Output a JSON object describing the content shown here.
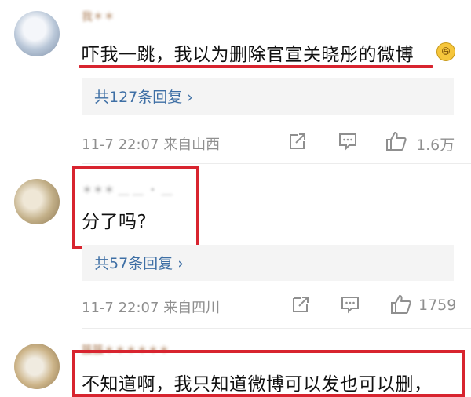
{
  "comments": [
    {
      "username": "我＊＊",
      "text": "吓我一跳，我以为删除官宣关晓彤的微博",
      "replies_label": "共127条回复 ›",
      "time": "11-7 22:07",
      "location": "来自山西",
      "likes": "1.6万"
    },
    {
      "username": "＊＊＊ ＿ ＿ ・ ＿",
      "text": "分了吗?",
      "replies_label": "共57条回复 ›",
      "time": "11-7 22:07",
      "location": "来自四川",
      "likes": "1759"
    },
    {
      "username": "簇簇＊＊＊＊＊＊",
      "text": "不知道啊，我只知道微博可以发也可以删，"
    }
  ],
  "icons": {
    "share": "share-icon",
    "comment": "comment-icon",
    "like": "thumbs-up-icon",
    "emoji": "laughing-emoji-icon"
  },
  "colors": {
    "highlight_red": "#d8242f",
    "link_blue": "#3e6fa5",
    "meta_gray": "#8f8f8f",
    "panel_bg": "#f4f4f4"
  }
}
